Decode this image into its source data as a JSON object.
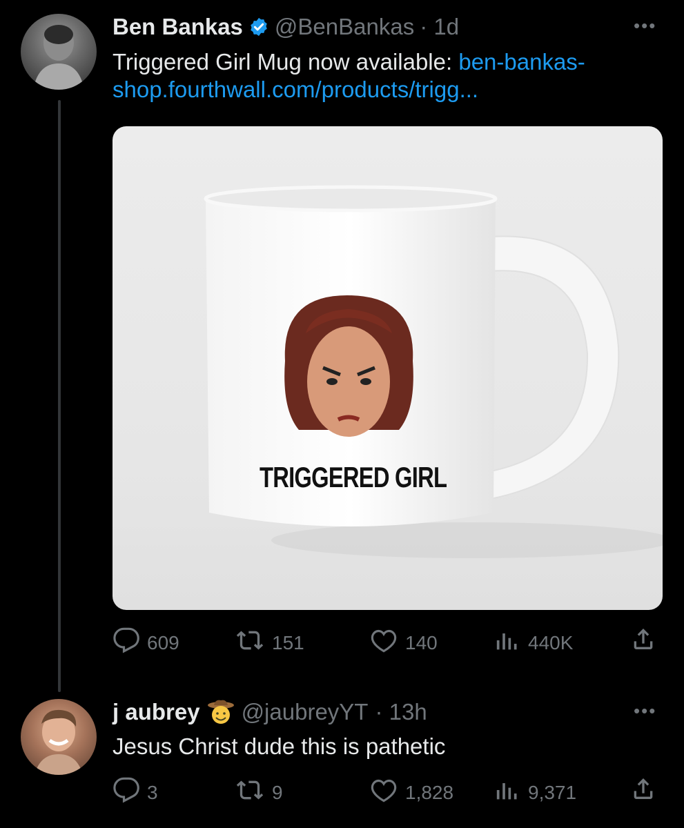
{
  "tweet1": {
    "name": "Ben Bankas",
    "handle": "@BenBankas",
    "time": "· 1d",
    "text_line1_plain": "Triggered Girl Mug now available: ",
    "text_line1_link": "ben-bankas-",
    "text_line2_link": "shop.fourthwall.com/products/trigg...",
    "media_text": "TRIGGERED GIRL",
    "replies": "609",
    "reposts": "151",
    "likes": "140",
    "views": "440K"
  },
  "tweet2": {
    "name": "j aubrey",
    "handle": "@jaubreyYT",
    "time": "· 13h",
    "text": "Jesus Christ dude this is pathetic",
    "replies": "3",
    "reposts": "9",
    "likes": "1,828",
    "views": "9,371"
  },
  "icons": {
    "verified": "verified-badge-icon",
    "cowboy": "cowboy-emoji-icon",
    "more": "more-icon",
    "reply": "reply-icon",
    "repost": "repost-icon",
    "like": "heart-icon",
    "views": "views-icon",
    "share": "share-icon"
  },
  "colors": {
    "background": "#000000",
    "text": "#e7e9ea",
    "muted": "#71767b",
    "link": "#1d9bf0",
    "verified": "#1d9bf0"
  }
}
